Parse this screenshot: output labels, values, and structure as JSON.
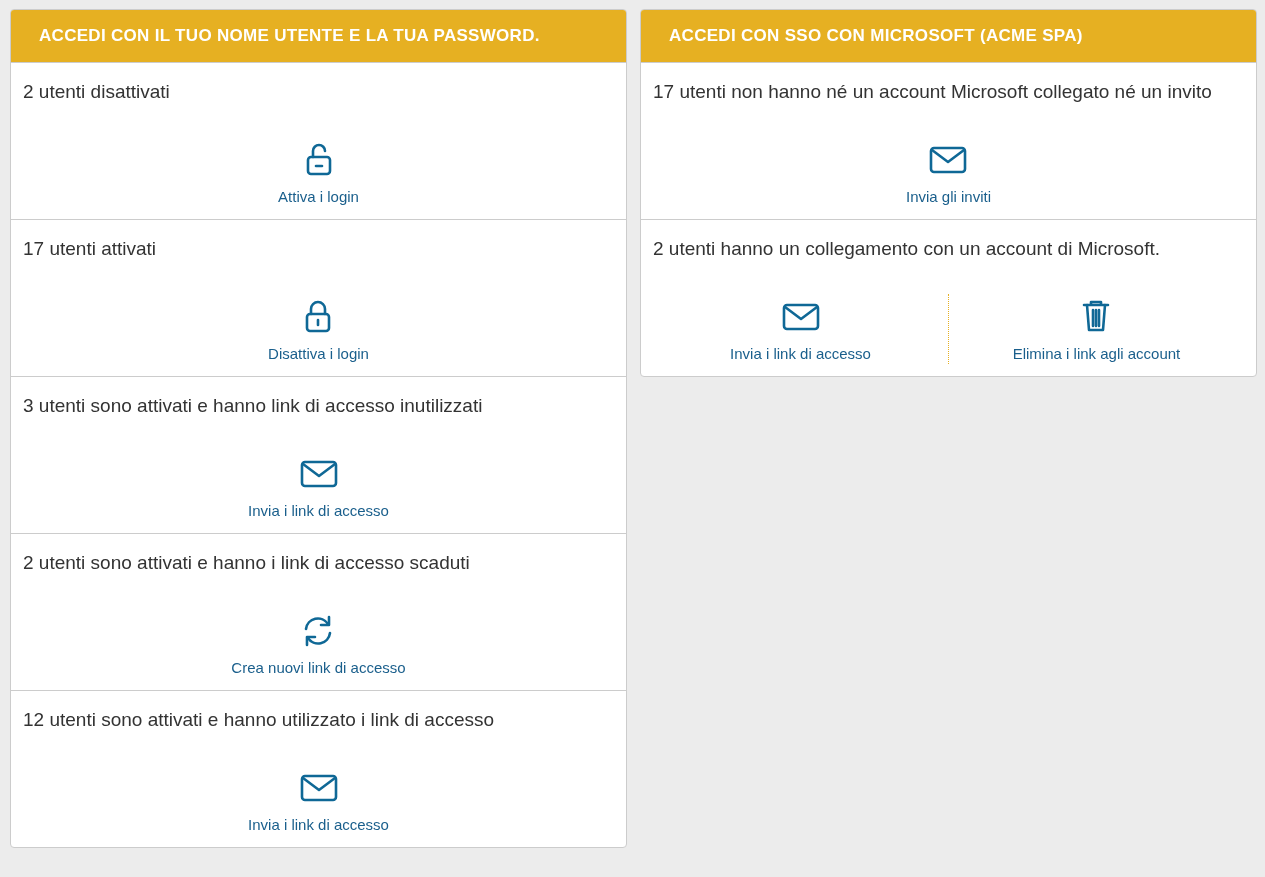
{
  "panels": [
    {
      "title": "ACCEDI CON IL TUO NOME UTENTE E LA TUA PASSWORD.",
      "sections": [
        {
          "text": "2 utenti disattivati",
          "actions": [
            {
              "kind": "unlock",
              "label": "Attiva i login"
            }
          ]
        },
        {
          "text": "17 utenti attivati",
          "actions": [
            {
              "kind": "lock",
              "label": "Disattiva i login"
            }
          ]
        },
        {
          "text": "3 utenti sono attivati e hanno link di accesso inutilizzati",
          "actions": [
            {
              "kind": "mail",
              "label": "Invia i link di accesso"
            }
          ]
        },
        {
          "text": "2 utenti sono attivati e hanno i link di accesso scaduti",
          "actions": [
            {
              "kind": "refresh",
              "label": "Crea nuovi link di accesso"
            }
          ]
        },
        {
          "text": "12 utenti sono attivati e hanno utilizzato i link di accesso",
          "actions": [
            {
              "kind": "mail",
              "label": "Invia i link di accesso"
            }
          ]
        }
      ]
    },
    {
      "title": "ACCEDI CON SSO CON MICROSOFT (ACME SPA)",
      "sections": [
        {
          "text": "17 utenti non hanno né un account Microsoft collegato né un invito",
          "actions": [
            {
              "kind": "mail",
              "label": "Invia gli inviti"
            }
          ]
        },
        {
          "text": "2 utenti hanno un collegamento con un account di Microsoft.",
          "actions": [
            {
              "kind": "mail",
              "label": "Invia i link di accesso"
            },
            {
              "kind": "trash",
              "label": "Elimina i link agli account"
            }
          ]
        }
      ]
    }
  ]
}
